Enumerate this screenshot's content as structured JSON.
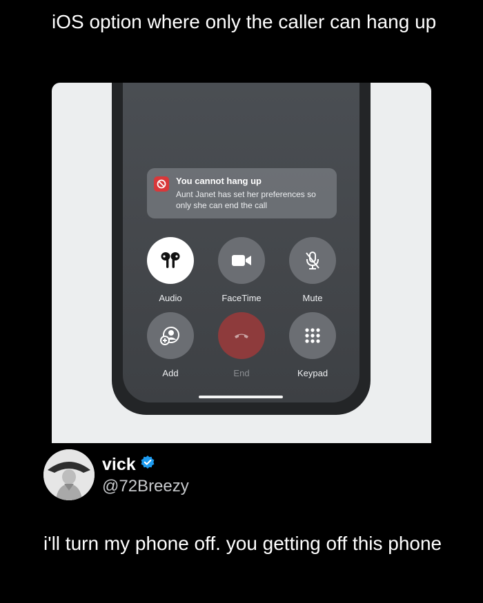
{
  "post": {
    "caption": "iOS option where only the caller can hang up"
  },
  "banner": {
    "title": "You cannot hang up",
    "message": "Aunt Janet has set her preferences so only she can end the call",
    "icon": "no-entry-icon",
    "badge_color": "#d9383a"
  },
  "controls": [
    {
      "label": "Audio",
      "icon": "airpods-icon"
    },
    {
      "label": "FaceTime",
      "icon": "video-camera-icon"
    },
    {
      "label": "Mute",
      "icon": "microphone-slash-icon"
    },
    {
      "label": "Add",
      "icon": "add-person-icon"
    },
    {
      "label": "End",
      "icon": "phone-hangup-icon",
      "state": "disabled"
    },
    {
      "label": "Keypad",
      "icon": "keypad-icon"
    }
  ],
  "reply": {
    "name": "vick",
    "verified": true,
    "handle": "@72Breezy",
    "text": "i'll turn my phone off. you getting off this phone",
    "verified_color": "#1d9bf0"
  }
}
